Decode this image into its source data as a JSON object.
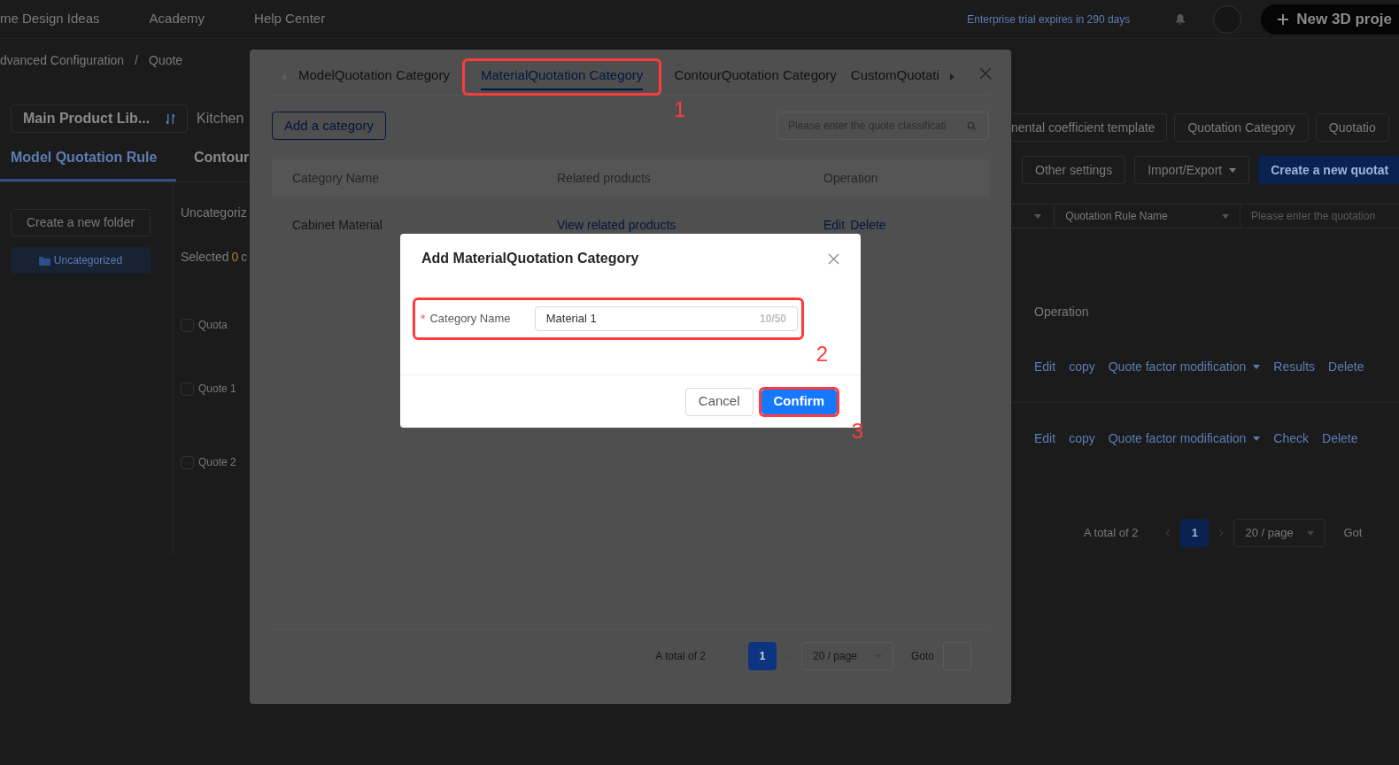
{
  "top_bar": {
    "links": [
      "me Design Ideas",
      "Academy",
      "Help Center"
    ],
    "trial_notice": "Enterprise trial expires in 290 days",
    "new_project_button": "New 3D proje"
  },
  "breadcrumb": [
    "dvanced Configuration",
    "Quote"
  ],
  "breadcrumb_separator": "/",
  "library_select": "Main Product Lib...",
  "library_tab_peek": "Kitchen",
  "rule_tabs": [
    {
      "label": "Model Quotation Rule",
      "selected": true
    },
    {
      "label": "Contour",
      "selected": false
    }
  ],
  "folder_panel": {
    "create_button": "Create a new folder",
    "folders": [
      {
        "label": "Uncategorized",
        "selected": true
      }
    ]
  },
  "list_peek": {
    "folder_title": "Uncategoriz",
    "selected_prefix": "Selected",
    "selected_count": "0",
    "selected_suffix": "c",
    "header": {
      "label": "Quota",
      "checked": false
    },
    "rows": [
      {
        "label": "Quote 1",
        "checked": false
      },
      {
        "label": "Quote 2",
        "checked": false
      }
    ]
  },
  "right_panel": {
    "top_buttons": [
      "nental coefficient template",
      "Quotation Category",
      "Quotatio"
    ],
    "action_buttons": [
      {
        "label": "Other settings",
        "kind": "plain"
      },
      {
        "label": "Import/Export",
        "kind": "dropdown"
      },
      {
        "label": "Create a new quotat",
        "kind": "primary"
      }
    ],
    "filter_select": "Quotation Rule Name",
    "filter_placeholder": "Please enter the quotation",
    "operation_header": "Operation",
    "rows": [
      {
        "actions": [
          {
            "label": "Edit",
            "dropdown": false
          },
          {
            "label": "copy",
            "dropdown": false
          },
          {
            "label": "Quote factor modification",
            "dropdown": true
          },
          {
            "label": "Results",
            "dropdown": false
          },
          {
            "label": "Delete",
            "dropdown": false
          }
        ]
      },
      {
        "actions": [
          {
            "label": "Edit",
            "dropdown": false
          },
          {
            "label": "copy",
            "dropdown": false
          },
          {
            "label": "Quote factor modification",
            "dropdown": true
          },
          {
            "label": "Check",
            "dropdown": false
          },
          {
            "label": "Delete",
            "dropdown": false
          }
        ]
      }
    ],
    "pagination": {
      "total": "A total of 2",
      "pages": [
        {
          "label": "1",
          "selected": true
        }
      ],
      "page_size": "20 / page",
      "goto": "Got"
    }
  },
  "category_modal": {
    "tabs": [
      {
        "label": "ModelQuotation Category",
        "selected": false
      },
      {
        "label": "MaterialQuotation Category",
        "selected": true,
        "annotation": "1"
      },
      {
        "label": "ContourQuotation Category",
        "selected": false
      },
      {
        "label": "CustomQuotati",
        "selected": false
      }
    ],
    "add_button": "Add a category",
    "search_placeholder": "Please enter the quote classificati",
    "columns": [
      "Category Name",
      "Related products",
      "Operation"
    ],
    "rows": [
      {
        "name": "Cabinet Material",
        "link": "View related products",
        "actions": [
          "Edit",
          "Delete"
        ]
      }
    ],
    "pagination": {
      "total": "A total of 2",
      "pages": [
        {
          "label": "1",
          "selected": true
        }
      ],
      "page_size": "20 / page",
      "goto": "Goto"
    }
  },
  "dialog": {
    "title": "Add MaterialQuotation Category",
    "field": {
      "label": "Category Name",
      "required_mark": "*",
      "value": "Material 1",
      "counter": "10/50",
      "annotation": "2"
    },
    "buttons": [
      {
        "label": "Cancel",
        "kind": "default"
      },
      {
        "label": "Confirm",
        "kind": "primary",
        "annotation": "3"
      }
    ]
  }
}
